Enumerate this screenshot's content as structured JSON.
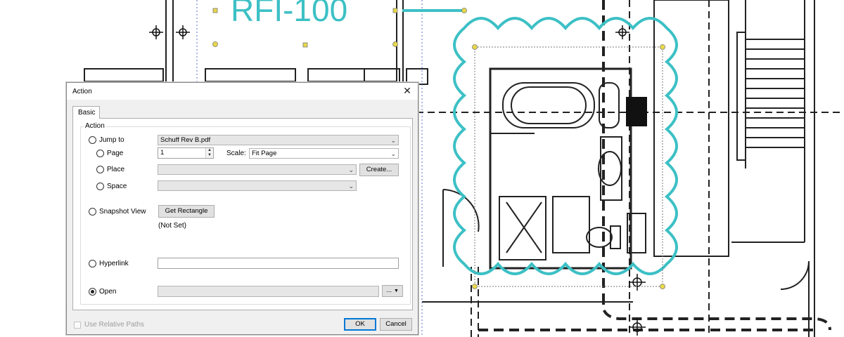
{
  "markup": {
    "callout_text": "RFI-100",
    "cloud_color": "#3cc0c5"
  },
  "dialog": {
    "title": "Action",
    "close_icon": "close-icon",
    "tab_label": "Basic",
    "group_label": "Action",
    "jump_to": {
      "label": "Jump to",
      "file_value": "Schuff Rev B.pdf",
      "page_label": "Page",
      "page_value": "1",
      "scale_label": "Scale:",
      "scale_value": "Fit Page",
      "place_label": "Place",
      "create_button": "Create...",
      "space_label": "Space"
    },
    "snapshot_view": {
      "label": "Snapshot View",
      "button": "Get Rectangle",
      "status": "(Not Set)"
    },
    "hyperlink": {
      "label": "Hyperlink",
      "value": ""
    },
    "open": {
      "label": "Open",
      "value": "",
      "browse_button": "...",
      "selected": true
    },
    "relative_paths_label": "Use Relative Paths",
    "ok_button": "OK",
    "cancel_button": "Cancel"
  }
}
